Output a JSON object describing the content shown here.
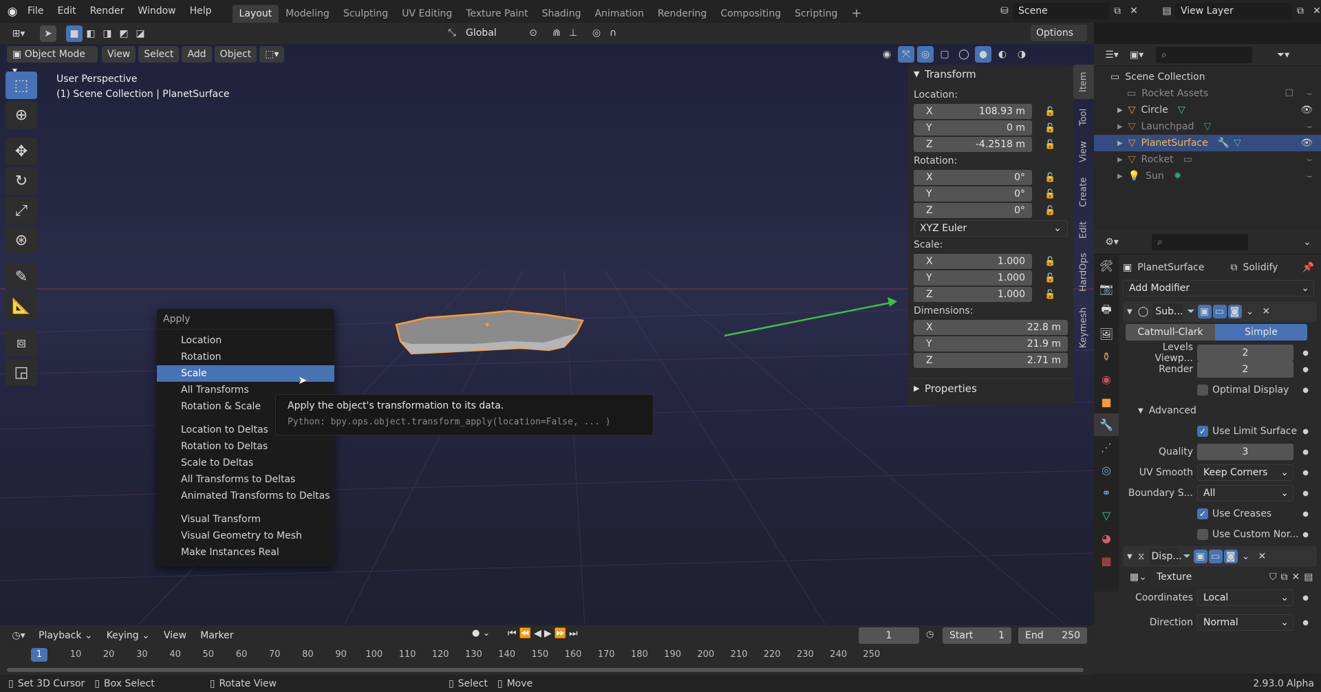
{
  "topbar": {
    "menus": [
      "File",
      "Edit",
      "Render",
      "Window",
      "Help"
    ],
    "workspaces": [
      "Layout",
      "Modeling",
      "Sculpting",
      "UV Editing",
      "Texture Paint",
      "Shading",
      "Animation",
      "Rendering",
      "Compositing",
      "Scripting"
    ],
    "active_workspace": "Layout",
    "scene": "Scene",
    "view_layer": "View Layer"
  },
  "toolbar": {
    "orientation": "Global",
    "options": "Options"
  },
  "viewport_header": {
    "mode": "Object Mode",
    "menus": [
      "View",
      "Select",
      "Add",
      "Object"
    ]
  },
  "viewport": {
    "perspective": "User Perspective",
    "collection_info": "(1) Scene Collection | PlanetSurface"
  },
  "context_menu": {
    "title": "Apply",
    "group1": [
      "Location",
      "Rotation",
      "Scale",
      "All Transforms",
      "Rotation & Scale"
    ],
    "highlighted": "Scale",
    "group2": [
      "Location to Deltas",
      "Rotation to Deltas",
      "Scale to Deltas",
      "All Transforms to Deltas",
      "Animated Transforms to Deltas"
    ],
    "group3": [
      "Visual Transform",
      "Visual Geometry to Mesh",
      "Make Instances Real"
    ]
  },
  "tooltip": {
    "text": "Apply the object's transformation to its data.",
    "python": "Python: bpy.ops.object.transform_apply(location=False, ... )"
  },
  "npanel": {
    "transform_header": "Transform",
    "location_label": "Location:",
    "location": [
      {
        "axis": "X",
        "value": "108.93 m"
      },
      {
        "axis": "Y",
        "value": "0 m"
      },
      {
        "axis": "Z",
        "value": "-4.2518 m"
      }
    ],
    "rotation_label": "Rotation:",
    "rotation": [
      {
        "axis": "X",
        "value": "0°"
      },
      {
        "axis": "Y",
        "value": "0°"
      },
      {
        "axis": "Z",
        "value": "0°"
      }
    ],
    "rotation_mode": "XYZ Euler",
    "scale_label": "Scale:",
    "scale": [
      {
        "axis": "X",
        "value": "1.000"
      },
      {
        "axis": "Y",
        "value": "1.000"
      },
      {
        "axis": "Z",
        "value": "1.000"
      }
    ],
    "dimensions_label": "Dimensions:",
    "dimensions": [
      {
        "axis": "X",
        "value": "22.8 m"
      },
      {
        "axis": "Y",
        "value": "21.9 m"
      },
      {
        "axis": "Z",
        "value": "2.71 m"
      }
    ],
    "properties_header": "Properties",
    "tabs": [
      "Item",
      "Tool",
      "View",
      "Create",
      "Edit",
      "HardOps",
      "Keymesh"
    ]
  },
  "outliner": {
    "root": "Scene Collection",
    "items": [
      {
        "name": "Rocket Assets",
        "selected": false
      },
      {
        "name": "Circle",
        "selected": false
      },
      {
        "name": "Launchpad",
        "selected": false
      },
      {
        "name": "PlanetSurface",
        "selected": true
      },
      {
        "name": "Rocket",
        "selected": false
      },
      {
        "name": "Sun",
        "selected": false
      }
    ]
  },
  "properties": {
    "object": "PlanetSurface",
    "modifier_name": "Solidify",
    "add_modifier": "Add Modifier",
    "subsurf_name": "Sub...",
    "catmull": "Catmull-Clark",
    "simple": "Simple",
    "levels_viewport_label": "Levels Viewp...",
    "levels_viewport": "2",
    "render_label": "Render",
    "render": "2",
    "optimal_display": "Optimal Display",
    "advanced": "Advanced",
    "use_limit_surface": "Use Limit Surface",
    "quality_label": "Quality",
    "quality": "3",
    "uv_smooth_label": "UV Smooth",
    "uv_smooth": "Keep Corners",
    "boundary_label": "Boundary S...",
    "boundary": "All",
    "use_creases": "Use Creases",
    "use_custom_normals": "Use Custom Nor...",
    "disp_name": "Disp...",
    "texture": "Texture",
    "coordinates_label": "Coordinates",
    "coordinates": "Local",
    "direction_label": "Direction",
    "direction": "Normal"
  },
  "timeline": {
    "menus": [
      "Playback",
      "Keying",
      "View",
      "Marker"
    ],
    "current_frame": "1",
    "start_label": "Start",
    "start": "1",
    "end_label": "End",
    "end": "250",
    "ticks": [
      "1",
      "10",
      "20",
      "30",
      "40",
      "50",
      "60",
      "70",
      "80",
      "90",
      "100",
      "110",
      "120",
      "130",
      "140",
      "150",
      "160",
      "170",
      "180",
      "190",
      "200",
      "210",
      "220",
      "230",
      "240",
      "250"
    ]
  },
  "statusbar": {
    "set_cursor": "Set 3D Cursor",
    "box_select": "Box Select",
    "rotate_view": "Rotate View",
    "select": "Select",
    "move": "Move",
    "version": "2.93.0 Alpha"
  },
  "colors": {
    "accent": "#4772b3",
    "selection": "#ff9a2e",
    "highlight_row": "#334d80"
  }
}
